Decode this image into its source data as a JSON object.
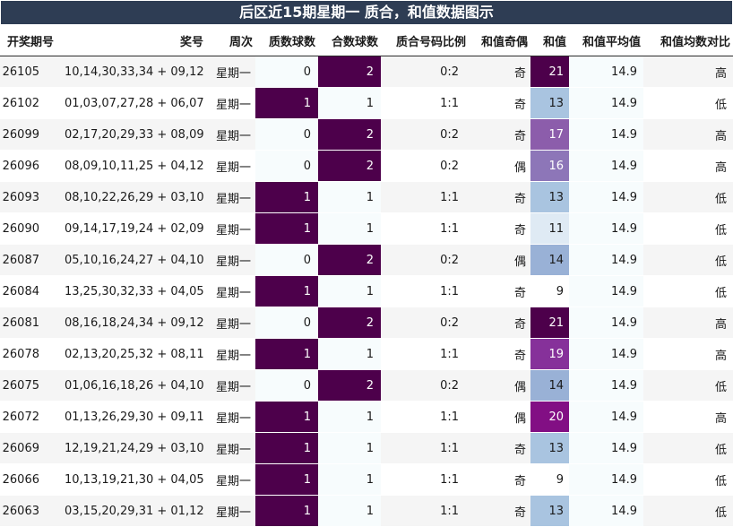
{
  "title": "后区近15期星期一 质合，和值数据图示",
  "headers": {
    "issue": "开奖期号",
    "numbers": "奖号",
    "weekday": "周次",
    "prime": "质数球数",
    "composite": "合数球数",
    "ratio": "质合号码比例",
    "parity": "和值奇偶",
    "sum": "和值",
    "avg": "和值平均值",
    "compare": "和值均数对比"
  },
  "colors": {
    "title_bg": "#2e3d54",
    "count_dark": "#4d004b",
    "count_light": "#f7fcfd",
    "sum_scale": {
      "9": "#ffffff",
      "11": "#dfeaf4",
      "13": "#a9c4e0",
      "14": "#99b1d6",
      "16": "#8d76b8",
      "17": "#8c5dab",
      "19": "#86319a",
      "20": "#820f84",
      "21": "#4d004b"
    }
  },
  "rows": [
    {
      "issue": "26105",
      "numbers": "10,14,30,33,34 + 09,12",
      "weekday": "星期一",
      "prime": "0",
      "composite": "2",
      "ratio": "0:2",
      "parity": "奇",
      "sum": "21",
      "avg": "14.9",
      "compare": "高"
    },
    {
      "issue": "26102",
      "numbers": "01,03,07,27,28 + 06,07",
      "weekday": "星期一",
      "prime": "1",
      "composite": "1",
      "ratio": "1:1",
      "parity": "奇",
      "sum": "13",
      "avg": "14.9",
      "compare": "低"
    },
    {
      "issue": "26099",
      "numbers": "02,17,20,29,33 + 08,09",
      "weekday": "星期一",
      "prime": "0",
      "composite": "2",
      "ratio": "0:2",
      "parity": "奇",
      "sum": "17",
      "avg": "14.9",
      "compare": "高"
    },
    {
      "issue": "26096",
      "numbers": "08,09,10,11,25 + 04,12",
      "weekday": "星期一",
      "prime": "0",
      "composite": "2",
      "ratio": "0:2",
      "parity": "偶",
      "sum": "16",
      "avg": "14.9",
      "compare": "高"
    },
    {
      "issue": "26093",
      "numbers": "08,10,22,26,29 + 03,10",
      "weekday": "星期一",
      "prime": "1",
      "composite": "1",
      "ratio": "1:1",
      "parity": "奇",
      "sum": "13",
      "avg": "14.9",
      "compare": "低"
    },
    {
      "issue": "26090",
      "numbers": "09,14,17,19,24 + 02,09",
      "weekday": "星期一",
      "prime": "1",
      "composite": "1",
      "ratio": "1:1",
      "parity": "奇",
      "sum": "11",
      "avg": "14.9",
      "compare": "低"
    },
    {
      "issue": "26087",
      "numbers": "05,10,16,24,27 + 04,10",
      "weekday": "星期一",
      "prime": "0",
      "composite": "2",
      "ratio": "0:2",
      "parity": "偶",
      "sum": "14",
      "avg": "14.9",
      "compare": "低"
    },
    {
      "issue": "26084",
      "numbers": "13,25,30,32,33 + 04,05",
      "weekday": "星期一",
      "prime": "1",
      "composite": "1",
      "ratio": "1:1",
      "parity": "奇",
      "sum": "9",
      "avg": "14.9",
      "compare": "低"
    },
    {
      "issue": "26081",
      "numbers": "08,16,18,24,34 + 09,12",
      "weekday": "星期一",
      "prime": "0",
      "composite": "2",
      "ratio": "0:2",
      "parity": "奇",
      "sum": "21",
      "avg": "14.9",
      "compare": "高"
    },
    {
      "issue": "26078",
      "numbers": "02,13,20,25,32 + 08,11",
      "weekday": "星期一",
      "prime": "1",
      "composite": "1",
      "ratio": "1:1",
      "parity": "奇",
      "sum": "19",
      "avg": "14.9",
      "compare": "高"
    },
    {
      "issue": "26075",
      "numbers": "01,06,16,18,26 + 04,10",
      "weekday": "星期一",
      "prime": "0",
      "composite": "2",
      "ratio": "0:2",
      "parity": "偶",
      "sum": "14",
      "avg": "14.9",
      "compare": "低"
    },
    {
      "issue": "26072",
      "numbers": "01,13,26,29,30 + 09,11",
      "weekday": "星期一",
      "prime": "1",
      "composite": "1",
      "ratio": "1:1",
      "parity": "偶",
      "sum": "20",
      "avg": "14.9",
      "compare": "高"
    },
    {
      "issue": "26069",
      "numbers": "12,19,21,24,29 + 03,10",
      "weekday": "星期一",
      "prime": "1",
      "composite": "1",
      "ratio": "1:1",
      "parity": "奇",
      "sum": "13",
      "avg": "14.9",
      "compare": "低"
    },
    {
      "issue": "26066",
      "numbers": "10,13,19,21,30 + 04,05",
      "weekday": "星期一",
      "prime": "1",
      "composite": "1",
      "ratio": "1:1",
      "parity": "奇",
      "sum": "9",
      "avg": "14.9",
      "compare": "低"
    },
    {
      "issue": "26063",
      "numbers": "03,15,20,29,31 + 01,12",
      "weekday": "星期一",
      "prime": "1",
      "composite": "1",
      "ratio": "1:1",
      "parity": "奇",
      "sum": "13",
      "avg": "14.9",
      "compare": "低"
    }
  ]
}
